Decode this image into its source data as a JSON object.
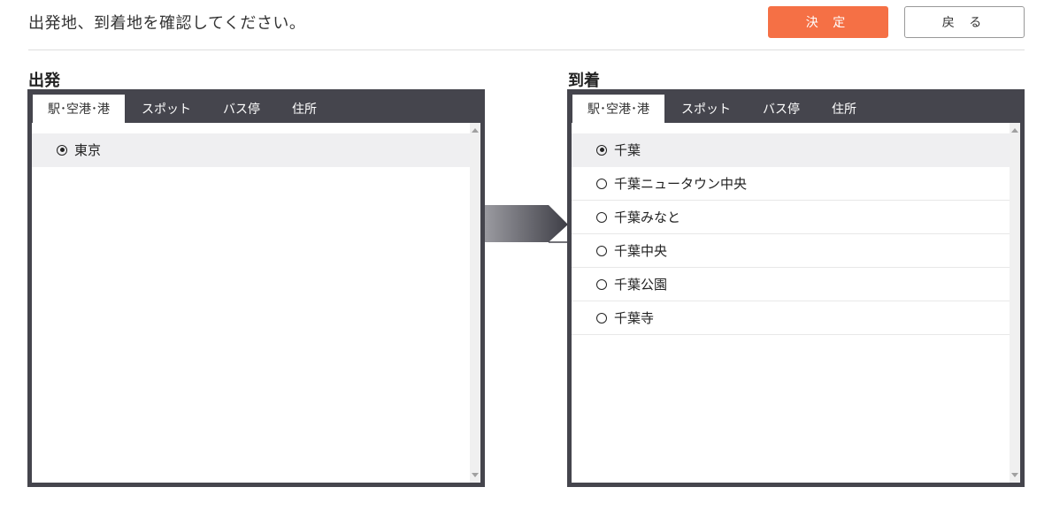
{
  "header": {
    "instruction": "出発地、到着地を確認してください。",
    "ok_label": "決 定",
    "back_label": "戻 る"
  },
  "departure": {
    "title": "出発",
    "tabs": [
      "駅･空港･港",
      "スポット",
      "バス停",
      "住所"
    ],
    "active_tab": 0,
    "items": [
      {
        "label": "東京",
        "selected": true
      }
    ]
  },
  "arrival": {
    "title": "到着",
    "tabs": [
      "駅･空港･港",
      "スポット",
      "バス停",
      "住所"
    ],
    "active_tab": 0,
    "items": [
      {
        "label": "千葉",
        "selected": true
      },
      {
        "label": "千葉ニュータウン中央",
        "selected": false
      },
      {
        "label": "千葉みなと",
        "selected": false
      },
      {
        "label": "千葉中央",
        "selected": false
      },
      {
        "label": "千葉公園",
        "selected": false
      },
      {
        "label": "千葉寺",
        "selected": false
      }
    ]
  },
  "colors": {
    "accent": "#f57045",
    "panel_frame": "#45454d"
  }
}
